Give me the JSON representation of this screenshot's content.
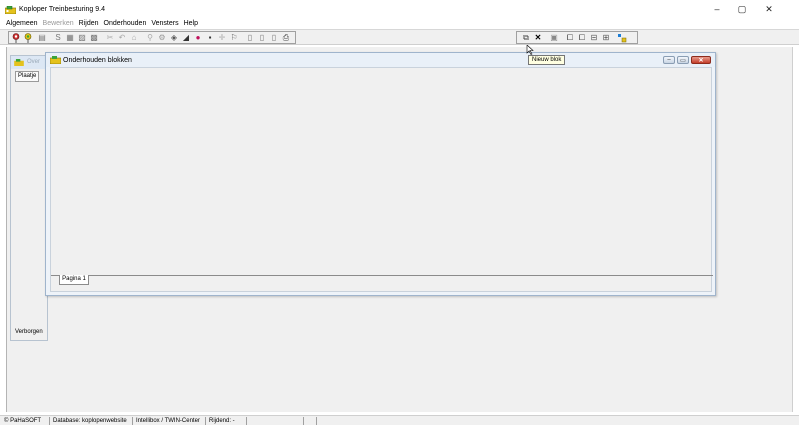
{
  "window": {
    "title": "Koploper Treinbesturing 9.4",
    "controls": {
      "minimize": "–",
      "maximize": "▢",
      "close": "✕"
    }
  },
  "menu": [
    {
      "label": "Algemeen",
      "enabled": true
    },
    {
      "label": "Bewerken",
      "enabled": false
    },
    {
      "label": "Rijden",
      "enabled": true
    },
    {
      "label": "Onderhouden",
      "enabled": true
    },
    {
      "label": "Vensters",
      "enabled": true
    },
    {
      "label": "Help",
      "enabled": true
    }
  ],
  "toolbar": {
    "left_icons": [
      "pin-green-icon",
      "pin-yellow-icon",
      "panel-icon",
      "s-icon",
      "grid-icon",
      "chart-icon",
      "chip-icon",
      "scissors-icon",
      "undo-icon",
      "home-icon",
      "filter-icon",
      "gear-icon",
      "loco-icon",
      "engine-icon",
      "car-icon",
      "dot-icon",
      "plus-icon",
      "route-icon",
      "doc-icon",
      "doc2-icon",
      "doc3-icon",
      "print-icon"
    ],
    "right_icons": [
      "new-block-icon",
      "delete-icon",
      "save-icon",
      "window-icon",
      "windows-icon",
      "window-link-icon",
      "tree-icon",
      "signal-icon"
    ]
  },
  "tooltip": {
    "text": "Nieuw blok"
  },
  "background_window": {
    "title": "Over",
    "tab": "Plaatje",
    "bottom_label": "Verborgen"
  },
  "child_window": {
    "title": "Onderhouden blokken",
    "tab_label": "Pagina 1",
    "controls": {
      "minimize": "–",
      "maximize": "▭",
      "close": "✕"
    }
  },
  "statusbar": {
    "segments": [
      "© PaHaSOFT",
      "Database: koplopenwebsite",
      "Intellibox / TWIN-Center",
      "Rijdend: -",
      "",
      "",
      ""
    ]
  },
  "colors": {
    "app_icon": "#c9a500",
    "title_blue": "#dce7f4",
    "close_red": "#c43d2a"
  }
}
